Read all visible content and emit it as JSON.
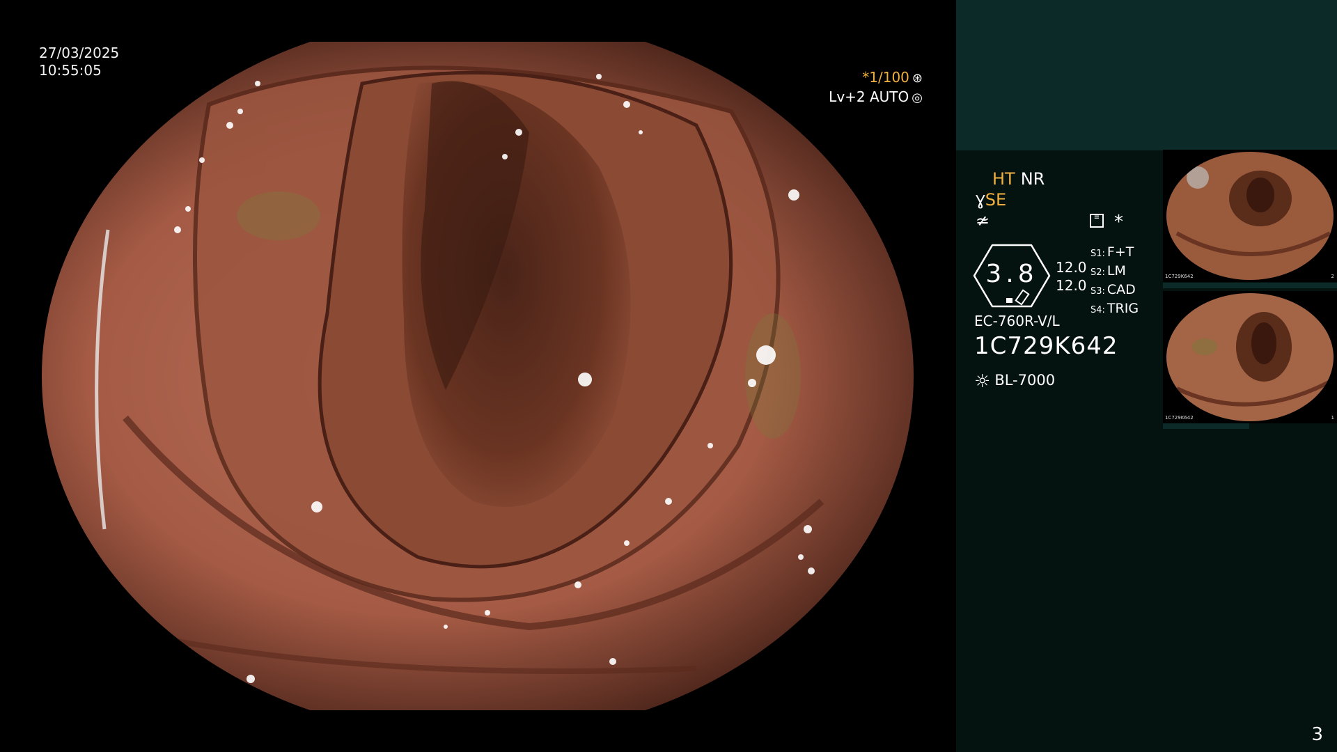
{
  "overlay": {
    "date": "27/03/2025",
    "time": "10:55:05",
    "shutter": "*1/100",
    "shutter_icon": "shutter-icon",
    "iris": "Lv+2 AUTO",
    "iris_icon": "iris-icon"
  },
  "panel": {
    "ht": "HT",
    "nr": "NR",
    "se_symbol": "Ɣ",
    "se": "SE",
    "cap_symbol": "≄",
    "star": "*",
    "gauge_value": "3.8",
    "gauge_left_1": "12.0",
    "gauge_left_2": "12.0",
    "s_labels": [
      {
        "key": "S1:",
        "value": "F+T"
      },
      {
        "key": "S2:",
        "value": "LM"
      },
      {
        "key": "S3:",
        "value": "CAD"
      },
      {
        "key": "S4:",
        "value": "TRIG"
      }
    ],
    "scope_model": "EC-760R-V/L",
    "scope_serial": "1C729K642",
    "light_source": "BL-7000",
    "page_number": "3"
  },
  "thumbnails": [
    {
      "serial": "1C729K642",
      "number": "2"
    },
    {
      "serial": "1C729K642",
      "number": "1"
    }
  ],
  "colors": {
    "accent_orange": "#f0b040",
    "panel_bg": "#04130f",
    "panel_band": "#0c2a27"
  }
}
